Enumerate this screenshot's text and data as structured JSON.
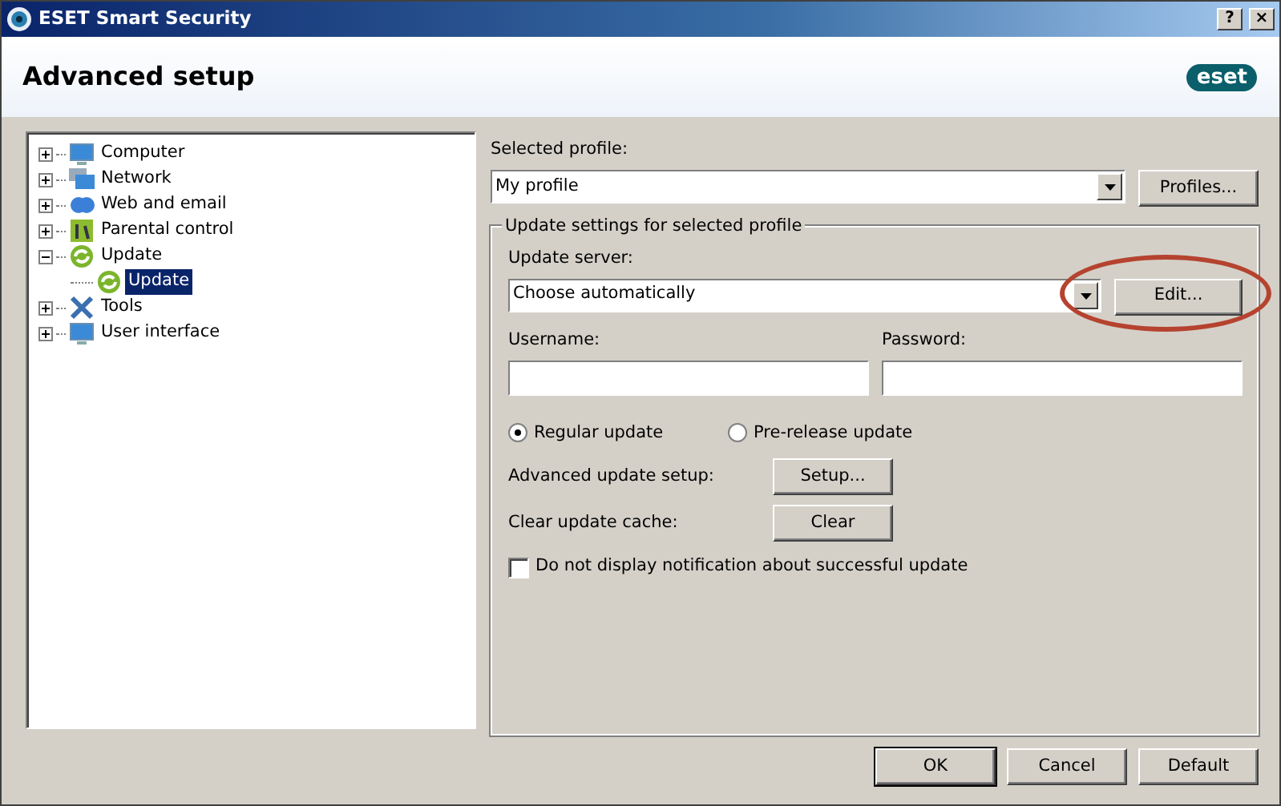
{
  "window": {
    "title": "ESET Smart Security",
    "controls": [
      "?",
      "×"
    ]
  },
  "header": {
    "title": "Advanced setup",
    "logo": "eset"
  },
  "tree": [
    {
      "label": "Computer",
      "expanded": false,
      "selected": false
    },
    {
      "label": "Network",
      "expanded": false,
      "selected": false
    },
    {
      "label": "Web and email",
      "expanded": false,
      "selected": false
    },
    {
      "label": "Parental control",
      "expanded": false,
      "selected": false
    },
    {
      "label": "Update",
      "expanded": true,
      "selected": false,
      "children": [
        {
          "label": "Update",
          "selected": true
        }
      ]
    },
    {
      "label": "Tools",
      "expanded": false,
      "selected": false
    },
    {
      "label": "User interface",
      "expanded": false,
      "selected": false
    }
  ],
  "profile": {
    "label": "Selected profile:",
    "value": "My profile",
    "button": "Profiles..."
  },
  "group": {
    "legend": "Update settings for selected profile",
    "server_label": "Update server:",
    "server_value": "Choose automatically",
    "edit_button": {
      "label": "Edit...",
      "highlighted": true
    },
    "username_label": "Username:",
    "password_label": "Password:",
    "radios": [
      {
        "label": "Regular update",
        "selected": true
      },
      {
        "label": "Pre-release update",
        "selected": false
      }
    ],
    "rows": [
      {
        "label": "Advanced update setup:",
        "button": "Setup..."
      },
      {
        "label": "Clear update cache:",
        "button": "Clear"
      }
    ],
    "checkbox": {
      "label": "Do not display notification about successful update",
      "checked": false
    }
  },
  "buttons": [
    {
      "label": "OK",
      "default": true
    },
    {
      "label": "Cancel",
      "default": false
    },
    {
      "label": "Default",
      "default": false
    }
  ]
}
